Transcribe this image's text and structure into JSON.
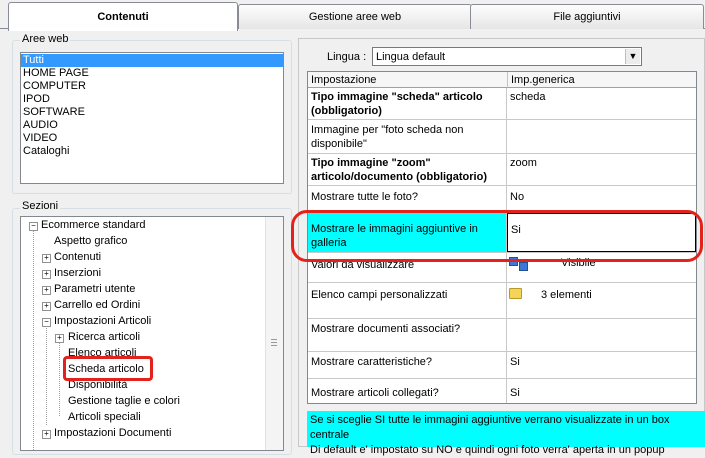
{
  "tabs": [
    {
      "label": "Contenuti",
      "active": true
    },
    {
      "label": "Gestione aree web",
      "active": false
    },
    {
      "label": "File aggiuntivi",
      "active": false
    }
  ],
  "aree_web": {
    "legend": "Aree web",
    "items": [
      "Tutti",
      "HOME PAGE",
      "COMPUTER",
      "IPOD",
      "SOFTWARE",
      "AUDIO",
      "VIDEO",
      "Cataloghi"
    ],
    "selected": "Tutti"
  },
  "sezioni": {
    "legend": "Sezioni",
    "nodes": [
      {
        "label": "Ecommerce standard",
        "expander": "-"
      },
      {
        "label": "Aspetto grafico",
        "expander": ""
      },
      {
        "label": "Contenuti",
        "expander": "+"
      },
      {
        "label": "Inserzioni",
        "expander": "+"
      },
      {
        "label": "Parametri utente",
        "expander": "+"
      },
      {
        "label": "Carrello ed Ordini",
        "expander": "+"
      },
      {
        "label": "Impostazioni Articoli",
        "expander": "-"
      },
      {
        "label": "Ricerca articoli",
        "expander": "+"
      },
      {
        "label": "Elenco articoli",
        "expander": ""
      },
      {
        "label": "Scheda articolo",
        "expander": ""
      },
      {
        "label": "Disponibilità",
        "expander": ""
      },
      {
        "label": "Gestione taglie e colori",
        "expander": ""
      },
      {
        "label": "Articoli speciali",
        "expander": ""
      },
      {
        "label": "Impostazioni Documenti",
        "expander": "+"
      }
    ],
    "highlighted": "Scheda articolo"
  },
  "lingua": {
    "label": "Lingua :",
    "value": "Lingua default"
  },
  "grid": {
    "headers": [
      "Impostazione",
      "Imp.generica"
    ],
    "rows": [
      {
        "setting": "Tipo immagine \"scheda\" articolo (obbligatorio)",
        "value": "scheda",
        "bold": true
      },
      {
        "setting": "Immagine per \"foto scheda non disponibile\"",
        "value": ""
      },
      {
        "setting": "Tipo immagine \"zoom\" articolo/documento (obbligatorio)",
        "value": "zoom",
        "bold": true
      },
      {
        "setting": "Mostrare tutte le foto?",
        "value": "No"
      },
      {
        "setting": "Mostrare le immagini aggiuntive in galleria",
        "value": "Si",
        "selected": true
      },
      {
        "setting": "Valori da visualizzare",
        "value": "Visibile",
        "icon": "list-icon"
      },
      {
        "setting": "Elenco campi personalizzati",
        "value": "3 elementi",
        "icon": "folder-icon"
      },
      {
        "setting": "Mostrare documenti associati?",
        "value": ""
      },
      {
        "setting": "Mostrare caratteristiche?",
        "value": "Si"
      },
      {
        "setting": "Mostrare articoli collegati?",
        "value": "Si"
      }
    ]
  },
  "description": {
    "line1": "Se si sceglie SI tutte le immagini aggiuntive verrano visualizzate in un box centrale",
    "line2": "Di default e' impostato su NO e quindi ogni foto verra' aperta in un popup"
  },
  "colors": {
    "highlight": "#00ffff",
    "selection": "#3399ff",
    "annotation": "#e3231b"
  }
}
